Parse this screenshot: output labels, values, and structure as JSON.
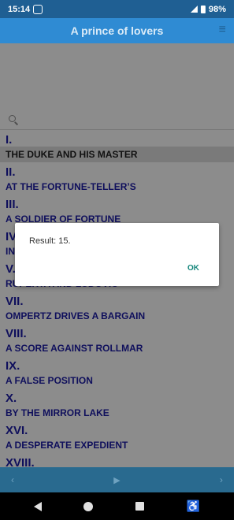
{
  "status": {
    "time": "15:14",
    "battery": "98%"
  },
  "appbar": {
    "title": "A prince of lovers"
  },
  "chapters": [
    {
      "num": "I.",
      "title": "THE DUKE AND HIS MASTER"
    },
    {
      "num": "II.",
      "title": "AT THE FORTUNE-TELLER’S"
    },
    {
      "num": "III.",
      "title": "A SOLDIER OF FORTUNE"
    },
    {
      "num": "IV.",
      "title": "IN"
    },
    {
      "num": "V.",
      "title": "RUPERTA AND LUDOVIC"
    },
    {
      "num": "VII.",
      "title": "OMPERTZ DRIVES A BARGAIN"
    },
    {
      "num": "VIII.",
      "title": "A SCORE AGAINST ROLLMAR"
    },
    {
      "num": "IX.",
      "title": "A FALSE POSITION"
    },
    {
      "num": "X.",
      "title": "BY THE MIRROR LAKE"
    },
    {
      "num": "XVI.",
      "title": "A DESPERATE EXPEDIENT"
    },
    {
      "num": "XVIII.",
      "title": ""
    }
  ],
  "nav": {
    "prev": "‹",
    "play": "▶",
    "next": "›"
  },
  "dialog": {
    "message": "Result: 15.",
    "ok": "OK"
  }
}
